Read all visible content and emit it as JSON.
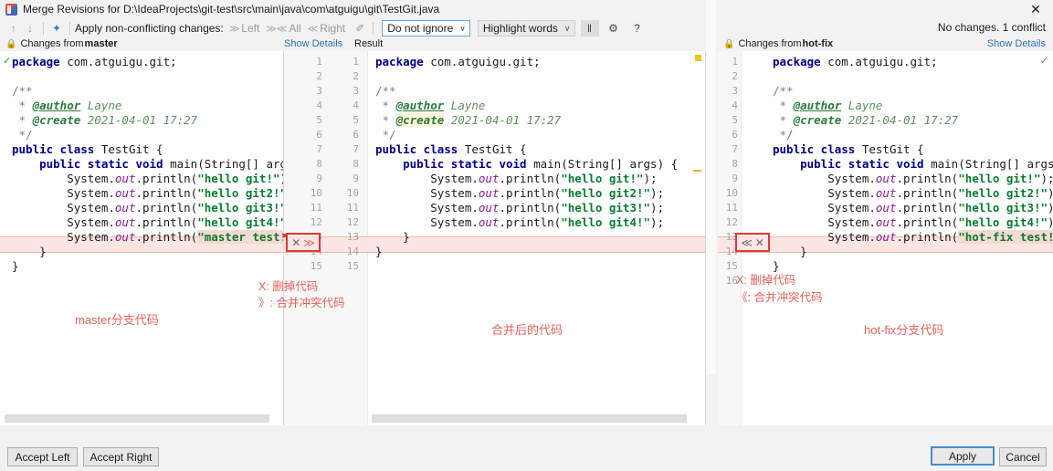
{
  "window": {
    "title": "Merge Revisions for D:\\IdeaProjects\\git-test\\src\\main\\java\\com\\atguigu\\git\\TestGit.java",
    "close_label": "✕",
    "app_icon": "intellij-idea-icon"
  },
  "toolbar": {
    "prev_label": "↑",
    "next_label": "↓",
    "apply_all_icon_label": "✦",
    "apply_text": "Apply non-conflicting changes:",
    "left_arrow": "≫",
    "left_label": "Left",
    "all_arrow": "≫≪",
    "all_label": "All",
    "right_arrow": "≪",
    "right_label": "Right",
    "magic_icon_label": "✐",
    "ignore_value": "Do not ignore",
    "highlight_value": "Highlight words",
    "combo_arrow": "∨",
    "columns_icon_label": "‖",
    "settings_icon_label": "⚙",
    "help_icon_label": "?",
    "status_text": "No changes. 1 conflict"
  },
  "headers": {
    "lock_icon": "ὑ2",
    "left_prefix": "Changes from ",
    "left_branch": "master",
    "right_prefix": "Changes from ",
    "right_branch": "hot-fix",
    "show_details_left": "Show Details",
    "show_details_right": "Show Details",
    "result_label": "Result"
  },
  "panes": {
    "left": {
      "name": "master-pane",
      "lines": [
        {
          "n": 1,
          "html": "<span class=\"kw\">package</span> com.atguigu.git;"
        },
        {
          "n": 2,
          "html": ""
        },
        {
          "n": 3,
          "html": "<span class=\"doc\">/**</span>"
        },
        {
          "n": 4,
          "html": "<span class=\"doc\"> * </span><span class=\"tag\">@author</span><span class=\"docit\"> Layne</span>"
        },
        {
          "n": 5,
          "html": "<span class=\"doc\"> * </span><span class=\"tag2\">@create</span><span class=\"docit\"> 2021-04-01 17:27</span>"
        },
        {
          "n": 6,
          "html": "<span class=\"doc\"> */</span>"
        },
        {
          "n": 7,
          "html": "<span class=\"kw\">public class</span> TestGit {"
        },
        {
          "n": 8,
          "html": "    <span class=\"kw\">public static void</span> main(String[] arg"
        },
        {
          "n": 9,
          "html": "        System.<span class=\"fld\">out</span>.println(<span class=\"str\">\"hello git!\"</span>)"
        },
        {
          "n": 10,
          "html": "        System.<span class=\"fld\">out</span>.println(<span class=\"str\">\"hello git2!\"</span>"
        },
        {
          "n": 11,
          "html": "        System.<span class=\"fld\">out</span>.println(<span class=\"str\">\"hello git3!\"</span>"
        },
        {
          "n": 12,
          "html": "        System.<span class=\"fld\">out</span>.println(<span class=\"str\">\"hello git4!\"</span>"
        },
        {
          "n": 13,
          "html": "        System.<span class=\"fld\">out</span>.println(<span class=\"str-conflict\">\"master test!</span>"
        },
        {
          "n": 14,
          "html": "    }"
        },
        {
          "n": 15,
          "html": "}"
        }
      ]
    },
    "center": {
      "name": "result-pane",
      "line_numbers_a": [
        1,
        2,
        3,
        4,
        5,
        6,
        7,
        8,
        9,
        10,
        11,
        12,
        13,
        14,
        15
      ],
      "line_numbers_b": [
        1,
        2,
        3,
        4,
        5,
        6,
        7,
        8,
        9,
        10,
        11,
        12,
        13,
        14,
        15
      ],
      "lines": [
        {
          "n": 1,
          "html": "<span class=\"kw\">package</span> com.atguigu.git;"
        },
        {
          "n": 2,
          "html": ""
        },
        {
          "n": 3,
          "html": "<span class=\"doc\">/**</span>"
        },
        {
          "n": 4,
          "html": "<span class=\"doc\"> * </span><span class=\"tag\">@author</span><span class=\"docit\"> Layne</span>"
        },
        {
          "n": 5,
          "html": "<span class=\"doc\"> * </span><span class=\"tag2 hl\">@create</span><span class=\"docit\"> 2021-04-01 17:27</span>"
        },
        {
          "n": 6,
          "html": "<span class=\"doc\"> */</span>"
        },
        {
          "n": 7,
          "html": "<span class=\"kw\">public class</span> TestGit {"
        },
        {
          "n": 8,
          "html": "    <span class=\"kw\">public static void</span> main(String[] args) {"
        },
        {
          "n": 9,
          "html": "        System.<span class=\"fld\">out</span>.println(<span class=\"str\">\"hello git!\"</span>);"
        },
        {
          "n": 10,
          "html": "        System.<span class=\"fld\">out</span>.println(<span class=\"str\">\"hello git2!\"</span>);"
        },
        {
          "n": 11,
          "html": "        System.<span class=\"fld\">out</span>.println(<span class=\"str\">\"hello git3!\"</span>);"
        },
        {
          "n": 12,
          "html": "        System.<span class=\"fld\">out</span>.println(<span class=\"str\">\"hello git4!\"</span>);"
        },
        {
          "n": 13,
          "html": "    }"
        },
        {
          "n": 14,
          "html": "}"
        },
        {
          "n": 15,
          "html": ""
        }
      ]
    },
    "right": {
      "name": "hotfix-pane",
      "line_numbers": [
        1,
        2,
        3,
        4,
        5,
        6,
        7,
        8,
        9,
        10,
        11,
        12,
        13,
        14,
        15,
        16
      ],
      "lines": [
        {
          "n": 1,
          "html": "<span class=\"kw\">package</span> com.atguigu.git;"
        },
        {
          "n": 2,
          "html": ""
        },
        {
          "n": 3,
          "html": "<span class=\"doc\">/**</span>"
        },
        {
          "n": 4,
          "html": "<span class=\"doc\"> * </span><span class=\"tag\">@author</span><span class=\"docit\"> Layne</span>"
        },
        {
          "n": 5,
          "html": "<span class=\"doc\"> * </span><span class=\"tag2\">@create</span><span class=\"docit\"> 2021-04-01 17:27</span>"
        },
        {
          "n": 6,
          "html": "<span class=\"doc\"> */</span>"
        },
        {
          "n": 7,
          "html": "<span class=\"kw\">public class</span> TestGit {"
        },
        {
          "n": 8,
          "html": "    <span class=\"kw\">public static void</span> main(String[] args"
        },
        {
          "n": 9,
          "html": "        System.<span class=\"fld\">out</span>.println(<span class=\"str\">\"hello git!\"</span>);"
        },
        {
          "n": 10,
          "html": "        System.<span class=\"fld\">out</span>.println(<span class=\"str\">\"hello git2!\"</span>)"
        },
        {
          "n": 11,
          "html": "        System.<span class=\"fld\">out</span>.println(<span class=\"str\">\"hello git3!\"</span>)"
        },
        {
          "n": 12,
          "html": "        System.<span class=\"fld\">out</span>.println(<span class=\"str\">\"hello git4!\"</span>)"
        },
        {
          "n": 13,
          "html": "        System.<span class=\"fld\">out</span>.println(<span class=\"str-conflict\">\"hot-fix test!</span>"
        },
        {
          "n": 14,
          "html": "    }"
        },
        {
          "n": 15,
          "html": "}"
        }
      ]
    }
  },
  "conflict_actions": {
    "center_box": {
      "remove": "✕",
      "merge": "≫"
    },
    "right_box": {
      "merge": "≪",
      "remove": "✕"
    },
    "left_box": {
      "remove": "✕",
      "merge": "≫"
    }
  },
  "annotations": {
    "center_line1": "X: 删掉代码",
    "center_line2": "》: 合并冲突代码",
    "right_line1": "X: 删掉代码",
    "right_line2": "《: 合并冲突代码",
    "label_left": "master分支代码",
    "label_center": "合并后的代码",
    "label_right": "hot-fix分支代码"
  },
  "footer": {
    "accept_left": "Accept Left",
    "accept_right": "Accept Right",
    "apply": "Apply",
    "cancel": "Cancel"
  },
  "colors": {
    "accent_red": "#e03a2f",
    "annotation_red": "#e8615a",
    "conflict_bg": "#fbe6e4",
    "link_blue": "#2f6fba",
    "keyword_blue": "#00008c",
    "string_green": "#087d2f"
  }
}
